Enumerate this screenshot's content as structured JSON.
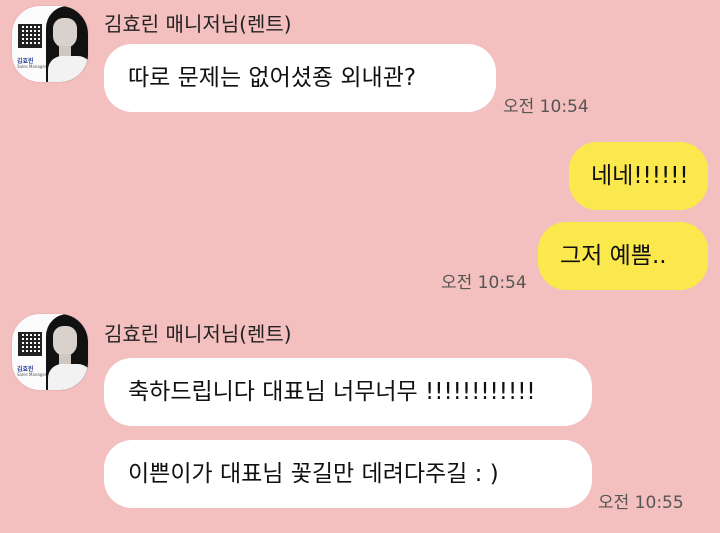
{
  "chat": {
    "groups": [
      {
        "sender": "김효린 매니저님(렌트)",
        "avatar": {
          "name": "김효린",
          "title": "Sales Manager"
        },
        "messages": [
          "따로 문제는 없어셨죵 외내관?"
        ],
        "time": "오전 10:54"
      },
      {
        "outgoing": true,
        "messages": [
          "네네!!!!!!",
          "그저 예쁨.."
        ],
        "time": "오전 10:54"
      },
      {
        "sender": "김효린 매니저님(렌트)",
        "avatar": {
          "name": "김효린",
          "title": "Sales Manager"
        },
        "messages": [
          "축하드립니다 대표님 너무너무 !!!!!!!!!!!!",
          "이쁜이가 대표님 꽃길만 데려다주길 : )"
        ],
        "time": "오전 10:55"
      }
    ]
  },
  "colors": {
    "background": "#f3bfbf",
    "incoming_bubble": "#ffffff",
    "outgoing_bubble": "#fbe84d"
  }
}
